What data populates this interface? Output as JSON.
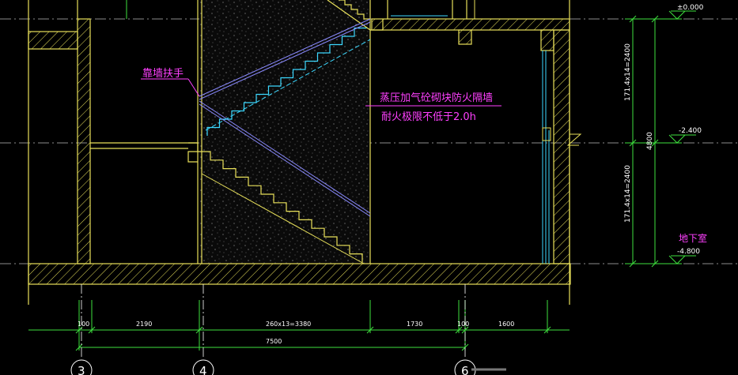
{
  "annotations": {
    "handrail": "靠墙扶手",
    "wall_line1": "蒸压加气砼砌块防火隔墙",
    "wall_line2": "耐火极限不低于2.0h"
  },
  "levels": {
    "top": "±0.000",
    "mid": "-2.400",
    "bottom": "-4.800",
    "basement": "地下室"
  },
  "vertical_dims": {
    "upper": "171.4x14=2400",
    "lower": "171.4x14=2400",
    "total": "4800"
  },
  "horizontal_dims": {
    "seg1": "100",
    "seg2": "2190",
    "seg3": "260x13=3380",
    "seg4": "1730",
    "seg5": "100",
    "seg6": "1600",
    "total": "7500"
  },
  "axes": {
    "a": "3",
    "b": "4",
    "c": "6"
  },
  "colors": {
    "wall": "#e8e05a",
    "dim": "#3ee03e",
    "stair_cyan": "#3cd8ff",
    "handrail": "#8a8aff",
    "magenta": "#ff40ff",
    "axis": "#ffffff",
    "grid_dash": "#bbbbbb",
    "text": "#ffffff"
  }
}
